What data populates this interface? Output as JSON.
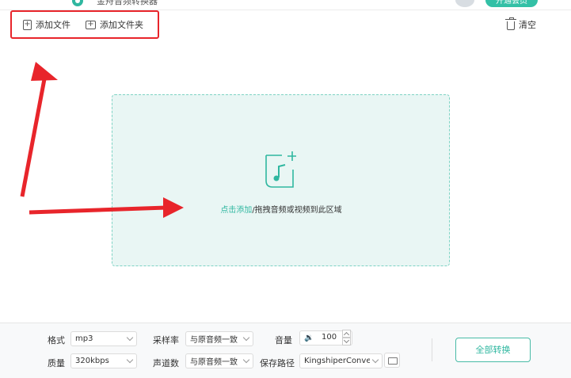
{
  "app": {
    "title": "金舟音频转换器",
    "vip_label": "开通会员"
  },
  "toolbar": {
    "add_file_label": "添加文件",
    "add_folder_label": "添加文件夹",
    "clear_label": "清空"
  },
  "dropzone": {
    "link_text": "点击添加",
    "hint_text": "/拖拽音频或视频到此区域"
  },
  "settings": {
    "format": {
      "label": "格式",
      "value": "mp3"
    },
    "quality": {
      "label": "质量",
      "value": "320kbps"
    },
    "sample_rate": {
      "label": "采样率",
      "value": "与原音频一致"
    },
    "channels": {
      "label": "声道数",
      "value": "与原音频一致"
    },
    "volume": {
      "label": "音量",
      "value": "100"
    },
    "save_path": {
      "label": "保存路径",
      "value": "KingshiperConver"
    }
  },
  "actions": {
    "convert_all_label": "全部转换"
  },
  "colors": {
    "accent": "#2fb7a0",
    "dropzone_bg": "#e9f6f4",
    "annotation_red": "#e8252b"
  }
}
